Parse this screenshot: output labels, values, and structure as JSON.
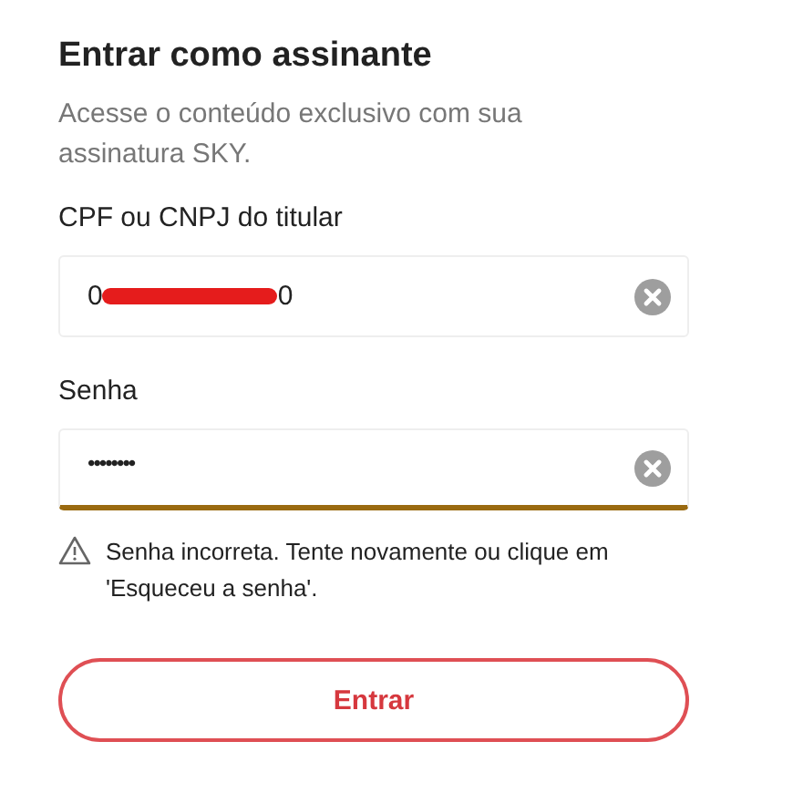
{
  "title": "Entrar como assinante",
  "subtitle": "Acesse o conteúdo exclusivo com sua assinatura SKY.",
  "fields": [
    {
      "label": "CPF ou CNPJ do titular",
      "kind": "text",
      "value_start": "0",
      "value_end": "0",
      "redacted": true,
      "clear_button": true,
      "error": false
    },
    {
      "label": "Senha",
      "kind": "password",
      "value_start": "••••••••",
      "clear_button": true,
      "error": true
    }
  ],
  "error_message": "Senha incorreta. Tente novamente ou clique em 'Esqueceu a senha'.",
  "submit": {
    "label": "Entrar",
    "disabled": false
  }
}
